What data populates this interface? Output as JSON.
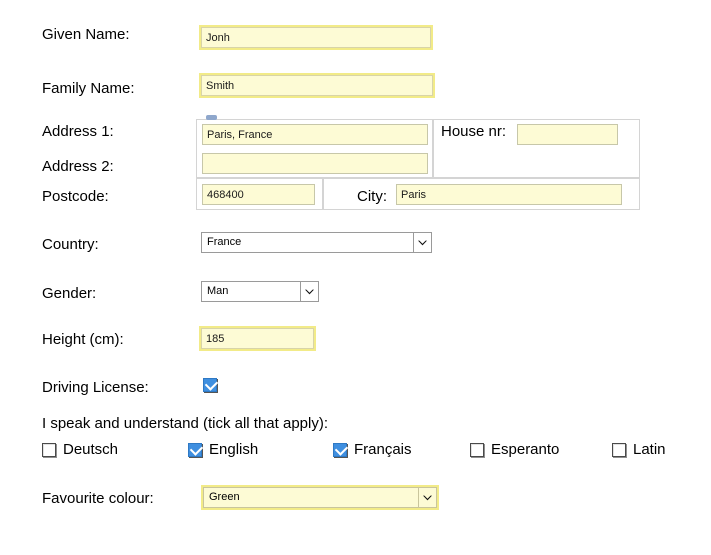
{
  "form": {
    "fields": [
      {
        "label": "Given Name:",
        "value": "Jonh",
        "placeholder": "",
        "type": "text-autofilled"
      },
      {
        "label": "Family Name:",
        "value": "Smith",
        "placeholder": "",
        "type": "text-autofilled"
      },
      {
        "label": "Address 1:",
        "value": "Paris, France",
        "placeholder": "",
        "type": "text-autofilled"
      },
      {
        "label": "Address 2:",
        "value": "",
        "placeholder": "",
        "type": "text-autofilled"
      },
      {
        "label": "Postcode:",
        "value": "468400",
        "placeholder": "",
        "type": "text-autofilled"
      },
      {
        "label": "House nr:",
        "value": "",
        "placeholder": "",
        "type": "text-autofilled"
      },
      {
        "label": "City:",
        "value": "Paris",
        "placeholder": "",
        "type": "text-autofilled"
      },
      {
        "label": "Country:",
        "value": "France",
        "placeholder": "",
        "type": "select"
      },
      {
        "label": "Gender:",
        "value": "Man",
        "placeholder": "",
        "type": "select"
      },
      {
        "label": "Height (cm):",
        "value": "185",
        "placeholder": "",
        "type": "text-autofilled"
      },
      {
        "label": "Driving License:",
        "value": "",
        "placeholder": "",
        "type": "checkbox"
      },
      {
        "label": "Favourite colour:",
        "value": "Green",
        "placeholder": "",
        "type": "select-autofilled"
      }
    ],
    "languages_legend": "I speak and understand (tick all that apply):",
    "languages": [
      {
        "label": "Deutsch",
        "checked": false
      },
      {
        "label": "English",
        "checked": true
      },
      {
        "label": "Français",
        "checked": true
      },
      {
        "label": "Esperanto",
        "checked": false
      },
      {
        "label": "Latin",
        "checked": false
      }
    ],
    "driving_license_checked": true,
    "icons": {
      "chevron_down": "chevron-down-icon",
      "checkmark": "checkmark-icon",
      "autofill_marker": "autofill-marker-icon"
    },
    "colors": {
      "autofill_fill": "#fdfbd5",
      "autofill_outline": "#f2eb88",
      "checkbox_checked": "#3f8fe0",
      "page_background": "#ffffff",
      "text": "#000000"
    }
  }
}
